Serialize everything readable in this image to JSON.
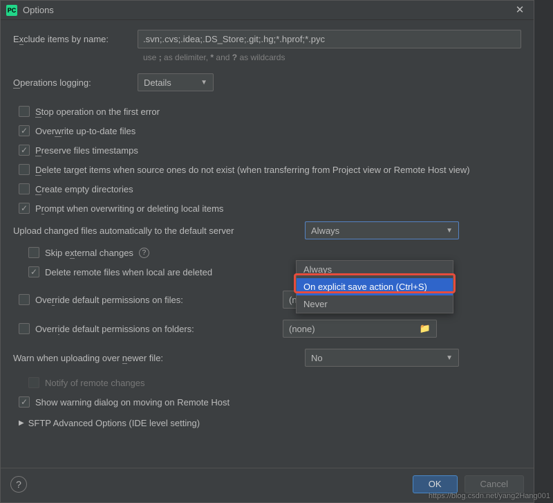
{
  "title": "Options",
  "exclude": {
    "label_pre": "E",
    "label_under": "x",
    "label_post": "clude items by name:",
    "value": ".svn;.cvs;.idea;.DS_Store;.git;.hg;*.hprof;*.pyc",
    "hint_pre": "use ",
    "hint_semi": ";",
    "hint_mid": " as delimiter, ",
    "hint_star": "*",
    "hint_and": " and ",
    "hint_q": "?",
    "hint_post": " as wildcards"
  },
  "ops": {
    "label_under": "O",
    "label_post": "perations logging:",
    "value": "Details"
  },
  "checks": {
    "stop": {
      "label_under": "S",
      "label_post": "top operation on the first error"
    },
    "overwrite": {
      "label_pre": "Over",
      "label_under": "w",
      "label_post": "rite up-to-date files"
    },
    "preserve": {
      "label_under": "P",
      "label_post": "reserve files timestamps"
    },
    "delete_target": {
      "label_under": "D",
      "label_post": "elete target items when source ones do not exist (when transferring from Project view or Remote Host view)"
    },
    "create_empty": {
      "label_under": "C",
      "label_post": "reate empty directories"
    },
    "prompt": {
      "label_pre": "P",
      "label_under": "r",
      "label_post": "ompt when overwriting or deleting local items"
    }
  },
  "upload": {
    "label": "Upload changed files automatically to the default server",
    "value": "Always",
    "options": [
      "Always",
      "On explicit save action (Ctrl+S)",
      "Never"
    ]
  },
  "skip_ext": {
    "label_pre": "Skip e",
    "label_under": "x",
    "label_post": "ternal changes"
  },
  "delete_remote": {
    "label": "Delete remote files when local are deleted"
  },
  "perm_files": {
    "label_pre": "Ove",
    "label_under": "r",
    "label_post": "ride default permissions on files:",
    "value": "(none)"
  },
  "perm_folders": {
    "label_pre": "Overr",
    "label_under": "i",
    "label_post": "de default permissions on folders:",
    "value": "(none)"
  },
  "warn": {
    "label_pre": "Warn when uploading over ",
    "label_under": "n",
    "label_post": "ewer file:",
    "value": "No"
  },
  "notify": {
    "label": "Notify of remote changes"
  },
  "show_warning": {
    "label": "Show warning dialog on moving on Remote Host"
  },
  "sftp": {
    "label": "SFTP Advanced Options (IDE level setting)"
  },
  "buttons": {
    "ok": "OK",
    "cancel": "Cancel"
  },
  "watermark": "https://blog.csdn.net/yang2Hang001"
}
